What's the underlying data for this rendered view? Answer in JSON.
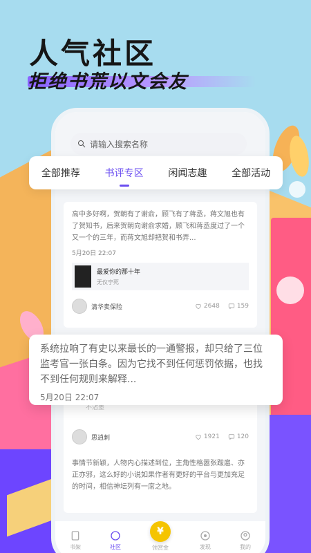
{
  "headline": {
    "title": "人气社区",
    "subtitle": "拒绝书荒以文会友"
  },
  "colors": {
    "accent": "#6a4df0",
    "gold": "#f5c400"
  },
  "search": {
    "placeholder": "请输入搜索名称"
  },
  "tabs": [
    {
      "label": "全部推荐"
    },
    {
      "label": "书评专区"
    },
    {
      "label": "闲闻志趣"
    },
    {
      "label": "全部活动"
    }
  ],
  "post1": {
    "text": "高中多好啊，贺朝有了谢俞，顾飞有了蒋丞，蒋文旭也有了贺知书，后来贺朝向谢俞求婚，顾飞和蒋丞度过了一个又一个的三年，而蒋文旭却把贺和书弄...",
    "date": "5月20日 22:07",
    "book_title": "最爱你的那十年",
    "book_author": "无仪宁死",
    "user": "清华卖保险",
    "likes": "2648",
    "comments": "159"
  },
  "post2": {
    "author_partial": "不沾墨",
    "user": "思逍刺",
    "likes": "1921",
    "comments": "120"
  },
  "post3": {
    "text": "事情节新颖，人物内心描述到位，主角性格嚣张跋扈、亦正亦邪，这么好的小说如果作者有更好的平台与更加充足的时间，相信神坛列有一席之地。"
  },
  "bubble": {
    "text": "系统拉响了有史以来最长的一通警报，却只给了三位监考官一张白条。因为它找不到任何惩罚依据，也找不到任何规则来解释...",
    "date": "5月20日 22:07"
  },
  "tabbar": [
    {
      "label": "书架",
      "icon": "bookshelf-icon"
    },
    {
      "label": "社区",
      "icon": "community-icon"
    },
    {
      "label": "领赏金",
      "icon": "coin-icon"
    },
    {
      "label": "发现",
      "icon": "discover-icon"
    },
    {
      "label": "我的",
      "icon": "profile-icon"
    }
  ]
}
